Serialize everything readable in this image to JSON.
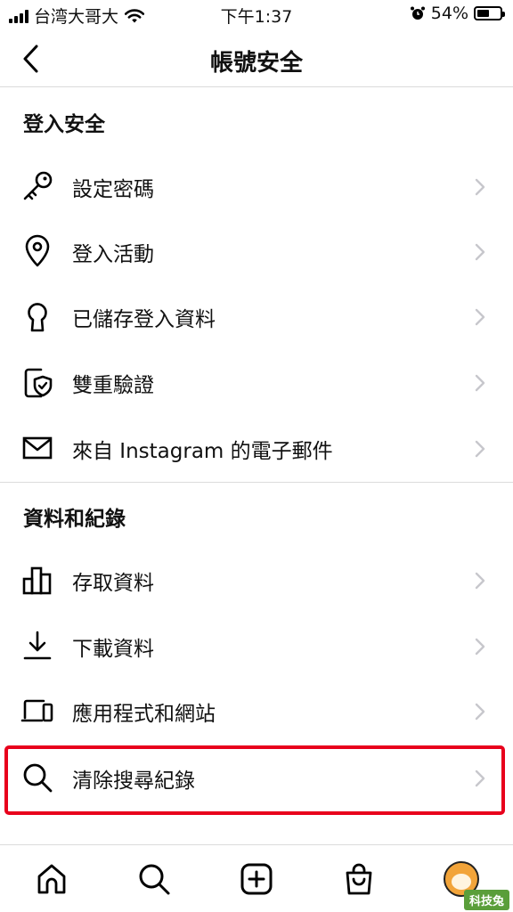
{
  "status_bar": {
    "carrier": "台湾大哥大",
    "time": "下午1:37",
    "battery_percent": "54%",
    "battery_level": 0.54
  },
  "header": {
    "title": "帳號安全"
  },
  "sections": [
    {
      "title": "登入安全",
      "items": [
        {
          "label": "設定密碼",
          "icon": "key-icon"
        },
        {
          "label": "登入活動",
          "icon": "location-pin-icon"
        },
        {
          "label": "已儲存登入資料",
          "icon": "keyhole-icon"
        },
        {
          "label": "雙重驗證",
          "icon": "phone-shield-icon"
        },
        {
          "label": "來自 Instagram 的電子郵件",
          "icon": "envelope-icon"
        }
      ]
    },
    {
      "title": "資料和紀錄",
      "items": [
        {
          "label": "存取資料",
          "icon": "bar-chart-icon"
        },
        {
          "label": "下載資料",
          "icon": "download-icon"
        },
        {
          "label": "應用程式和網站",
          "icon": "devices-icon"
        },
        {
          "label": "清除搜尋紀錄",
          "icon": "search-icon"
        }
      ]
    }
  ],
  "tab_bar": {
    "tabs": [
      "home-icon",
      "search-icon",
      "create-icon",
      "shop-icon",
      "profile-avatar"
    ]
  },
  "watermark": "科技兔",
  "colors": {
    "highlight": "#e8001c",
    "divider": "#dbdbdb",
    "chevron": "#c7c7cc",
    "avatar": "#f2a43a"
  }
}
